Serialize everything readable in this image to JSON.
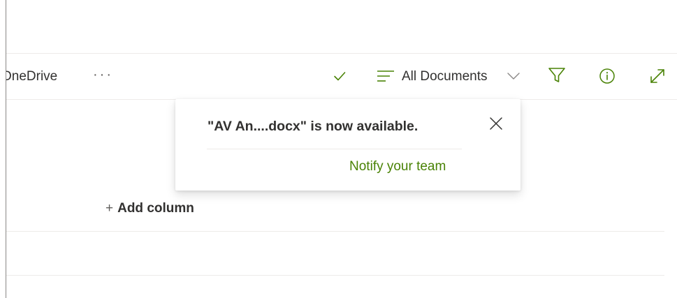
{
  "command_bar": {
    "location_label": "OneDrive",
    "more_label": "···",
    "view_label": "All Documents"
  },
  "icons": {
    "check": "checkmark-icon",
    "view_list": "list-lines-icon",
    "chevron": "chevron-down-icon",
    "filter": "filter-icon",
    "info": "info-icon",
    "expand": "expand-icon",
    "close": "close-icon"
  },
  "notification": {
    "message": "\"AV An....docx\" is now available.",
    "action_label": "Notify your team"
  },
  "list": {
    "add_column_plus": "+",
    "add_column_label": "Add column"
  },
  "colors": {
    "accent": "#498205",
    "text": "#323130",
    "divider": "#edebe9"
  }
}
